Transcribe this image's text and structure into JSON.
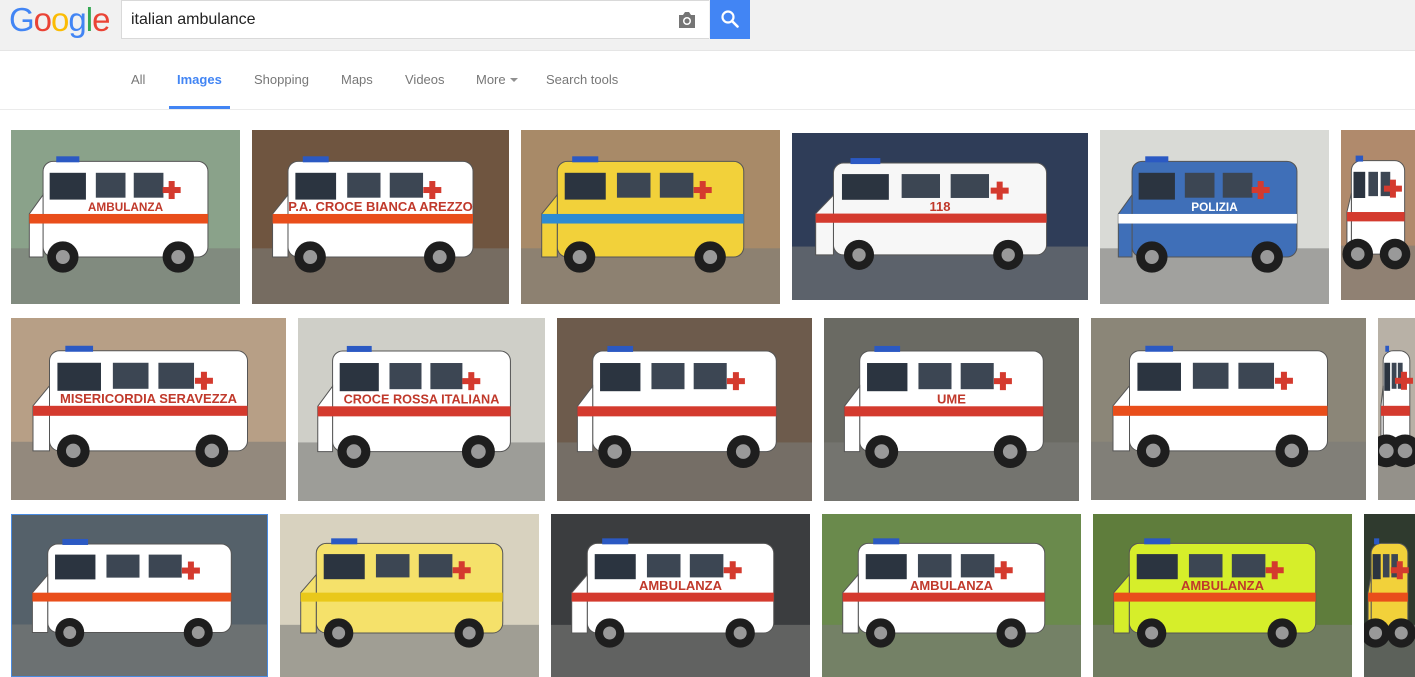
{
  "logo": {
    "letters": [
      "G",
      "o",
      "o",
      "g",
      "l",
      "e"
    ],
    "colors": [
      "#4285f4",
      "#ea4335",
      "#fbbc05",
      "#4285f4",
      "#34a853",
      "#ea4335"
    ]
  },
  "search": {
    "query": "italian ambulance",
    "placeholder": ""
  },
  "icons": {
    "camera": "camera-icon",
    "search": "search-icon"
  },
  "tabs": [
    {
      "label": "All",
      "active": false
    },
    {
      "label": "Images",
      "active": true
    },
    {
      "label": "Shopping",
      "active": false
    },
    {
      "label": "Maps",
      "active": false
    },
    {
      "label": "Videos",
      "active": false
    },
    {
      "label": "More",
      "active": false
    },
    {
      "label": "Search tools",
      "active": false
    }
  ],
  "results": {
    "row1": [
      {
        "label": "AMBULANZA",
        "body": "#ffffff",
        "stripe": "#e94e1b",
        "bg": "#8aa28a"
      },
      {
        "label": "P.A. CROCE BIANCA AREZZO",
        "body": "#ffffff",
        "stripe": "#e94e1b",
        "bg": "#6f5540"
      },
      {
        "label": "",
        "body": "#f2d13a",
        "stripe": "#2e8bd2",
        "bg": "#a88a68"
      },
      {
        "label": "118",
        "body": "#f7f7f7",
        "stripe": "#d43a2e",
        "bg": "#2f3d58"
      },
      {
        "label": "POLIZIA",
        "body": "#3f6fb8",
        "stripe": "#ffffff",
        "bg": "#d9dad6"
      },
      {
        "label": "",
        "body": "#ffffff",
        "stripe": "#d43a2e",
        "bg": "#b08a6c"
      }
    ],
    "row2": [
      {
        "label": "MISERICORDIA SERAVEZZA",
        "body": "#ffffff",
        "stripe": "#d43a2e",
        "bg": "#b79f86"
      },
      {
        "label": "CROCE ROSSA ITALIANA",
        "body": "#ffffff",
        "stripe": "#d43a2e",
        "bg": "#cfcfc8"
      },
      {
        "label": "",
        "body": "#ffffff",
        "stripe": "#d43a2e",
        "bg": "#6d5b4c"
      },
      {
        "label": "UME",
        "body": "#ffffff",
        "stripe": "#d43a2e",
        "bg": "#6a6a63"
      },
      {
        "label": "",
        "body": "#ffffff",
        "stripe": "#e94e1b",
        "bg": "#8b8678"
      },
      {
        "label": "",
        "body": "#ffffff",
        "stripe": "#d43a2e",
        "bg": "#b8b1a6"
      }
    ],
    "row3": [
      {
        "label": "",
        "body": "#ffffff",
        "stripe": "#e94e1b",
        "bg": "#55616a"
      },
      {
        "label": "",
        "body": "#f5e16a",
        "stripe": "#e9c81a",
        "bg": "#d8d2bf"
      },
      {
        "label": "AMBULANZA",
        "body": "#ffffff",
        "stripe": "#d43a2e",
        "bg": "#3b3d3f"
      },
      {
        "label": "AMBULANZA",
        "body": "#ffffff",
        "stripe": "#d43a2e",
        "bg": "#6a8a4c"
      },
      {
        "label": "AMBULANZA",
        "body": "#d6ee2a",
        "stripe": "#e94e1b",
        "bg": "#5f7d3c"
      },
      {
        "label": "",
        "body": "#f2d13a",
        "stripe": "#e94e1b",
        "bg": "#2f3a2e"
      }
    ]
  }
}
